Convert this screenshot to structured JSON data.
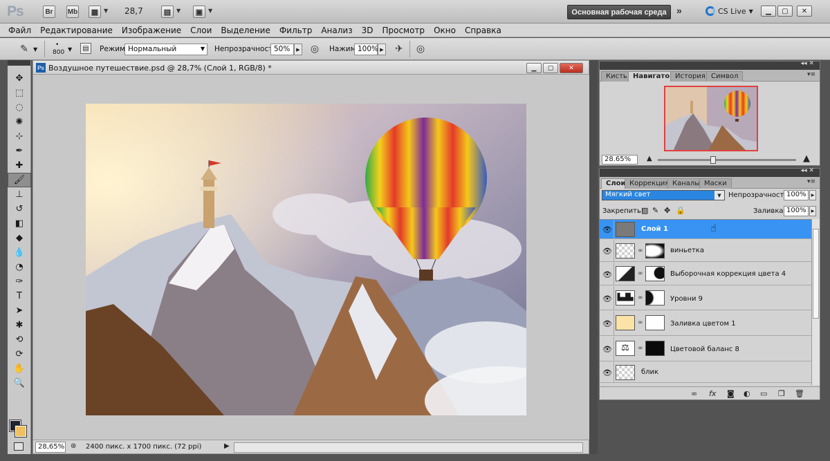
{
  "appbar": {
    "logo": "Ps",
    "bridge_label": "Br",
    "minibridge_label": "Mb",
    "zoom_value": "28,7",
    "workspace_label": "Основная рабочая среда",
    "cslive_label": "CS Live"
  },
  "menu": [
    "Файл",
    "Редактирование",
    "Изображение",
    "Слои",
    "Выделение",
    "Фильтр",
    "Анализ",
    "3D",
    "Просмотр",
    "Окно",
    "Справка"
  ],
  "options": {
    "brush_size": "800",
    "mode_label": "Режим:",
    "mode_value": "Нормальный",
    "opacity_label": "Непрозрачность:",
    "opacity_value": "50%",
    "flow_label": "Нажим:",
    "flow_value": "100%"
  },
  "document": {
    "title": "Воздушное путешествие.psd @ 28,7% (Слой 1, RGB/8) *",
    "zoom": "28,65%",
    "info": "2400 пикс. х 1700 пикс. (72 ppi)"
  },
  "navigator": {
    "tabs": [
      "Кисть",
      "Навигатор",
      "История",
      "Символ"
    ],
    "active_tab": 1,
    "zoom": "28.65%"
  },
  "layers_panel": {
    "tabs": [
      "Слои",
      "Коррекция",
      "Каналы",
      "Маски"
    ],
    "active_tab": 0,
    "blend_mode": "Мягкий свет",
    "opacity_label": "Непрозрачность:",
    "opacity_value": "100%",
    "lock_label": "Закрепить:",
    "fill_label": "Заливка:",
    "fill_value": "100%",
    "layers": [
      {
        "name": "Слой 1",
        "selected": true,
        "thumb": "gray",
        "mask": false
      },
      {
        "name": "виньетка",
        "selected": false,
        "thumb": "checker",
        "mask": true
      },
      {
        "name": "Выборочная коррекция цвета 4",
        "selected": false,
        "thumb": "selective",
        "mask": true
      },
      {
        "name": "Уровни 9",
        "selected": false,
        "thumb": "levels",
        "mask": true
      },
      {
        "name": "Заливка цветом 1",
        "selected": false,
        "thumb": "cream",
        "mask": true
      },
      {
        "name": "Цветовой баланс 8",
        "selected": false,
        "thumb": "balance",
        "mask": true
      },
      {
        "name": "блик",
        "selected": false,
        "thumb": "checker",
        "mask": false
      }
    ]
  },
  "colors": {
    "accent": "#3893f2",
    "foreground": "#1e2330",
    "background": "#f0c060"
  }
}
